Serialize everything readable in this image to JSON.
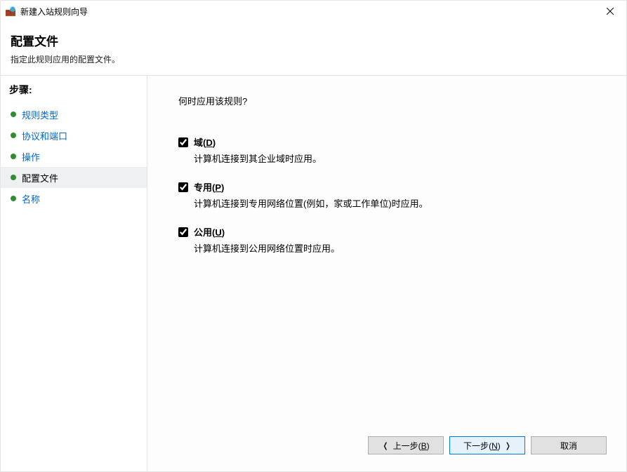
{
  "window": {
    "title": "新建入站规则向导"
  },
  "header": {
    "title": "配置文件",
    "subtitle": "指定此规则应用的配置文件。"
  },
  "sidebar": {
    "heading": "步骤:",
    "items": [
      {
        "label": "规则类型",
        "current": false
      },
      {
        "label": "协议和端口",
        "current": false
      },
      {
        "label": "操作",
        "current": false
      },
      {
        "label": "配置文件",
        "current": true
      },
      {
        "label": "名称",
        "current": false
      }
    ]
  },
  "content": {
    "question": "何时应用该规则?",
    "options": [
      {
        "label_prefix": "域",
        "mnemonic": "D",
        "checked": true,
        "description": "计算机连接到其企业域时应用。"
      },
      {
        "label_prefix": "专用",
        "mnemonic": "P",
        "checked": true,
        "description": "计算机连接到专用网络位置(例如，家或工作单位)时应用。"
      },
      {
        "label_prefix": "公用",
        "mnemonic": "U",
        "checked": true,
        "description": "计算机连接到公用网络位置时应用。"
      }
    ]
  },
  "footer": {
    "back_prefix": "上一步",
    "back_mnemonic": "B",
    "next_prefix": "下一步",
    "next_mnemonic": "N",
    "cancel": "取消"
  }
}
